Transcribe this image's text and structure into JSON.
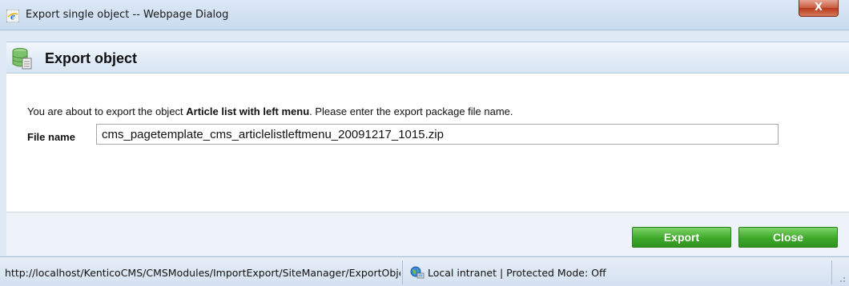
{
  "window": {
    "title": "Export single object -- Webpage Dialog",
    "close_label": "X"
  },
  "header": {
    "title": "Export object"
  },
  "content": {
    "message_prefix": "You are about to export the object ",
    "object_name": "Article list with left menu",
    "message_suffix": ". Please enter the export package file name.",
    "file_label": "File name",
    "file_value": "cms_pagetemplate_cms_articlelistleftmenu_20091217_1015.zip"
  },
  "footer": {
    "export_label": "Export",
    "close_label": "Close"
  },
  "statusbar": {
    "url": "http://localhost/KenticoCMS/CMSModules/ImportExport/SiteManager/ExportObject.aspx",
    "zone": "Local intranet | Protected Mode: Off"
  },
  "icons": {
    "browser": "ie-icon",
    "header": "database-export-icon",
    "zone": "local-intranet-icon"
  },
  "colors": {
    "button_green": "#3fa82a",
    "header_band": "#d6e4f3",
    "close_red": "#c75a3f"
  }
}
